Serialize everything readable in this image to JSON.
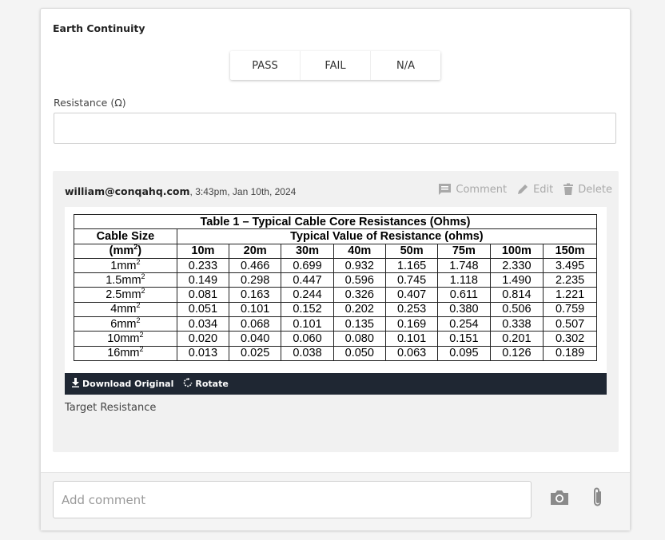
{
  "section": {
    "title": "Earth Continuity"
  },
  "options": [
    "PASS",
    "FAIL",
    "N/A"
  ],
  "resistance": {
    "label": "Resistance (Ω)",
    "value": ""
  },
  "comment": {
    "author": "william@conqahq.com",
    "timestamp": ", 3:43pm, Jan 10th, 2024",
    "actions": {
      "comment": "Comment",
      "edit": "Edit",
      "delete": "Delete"
    },
    "image_bar": {
      "download": "Download Original",
      "rotate": "Rotate"
    },
    "caption": "Target Resistance"
  },
  "table": {
    "title": "Table 1 – Typical Cable Core Resistances (Ohms)",
    "col_header": "Typical Value of Resistance (ohms)",
    "size_header_line1": "Cable Size",
    "size_header_line2": "(mm",
    "size_header_sup": "2",
    "size_header_line2_end": ")",
    "lengths": [
      "10m",
      "20m",
      "30m",
      "40m",
      "50m",
      "75m",
      "100m",
      "150m"
    ],
    "rows": [
      {
        "size": "1mm",
        "values": [
          "0.233",
          "0.466",
          "0.699",
          "0.932",
          "1.165",
          "1.748",
          "2.330",
          "3.495"
        ]
      },
      {
        "size": "1.5mm",
        "values": [
          "0.149",
          "0.298",
          "0.447",
          "0.596",
          "0.745",
          "1.118",
          "1.490",
          "2.235"
        ]
      },
      {
        "size": "2.5mm",
        "values": [
          "0.081",
          "0.163",
          "0.244",
          "0.326",
          "0.407",
          "0.611",
          "0.814",
          "1.221"
        ]
      },
      {
        "size": "4mm",
        "values": [
          "0.051",
          "0.101",
          "0.152",
          "0.202",
          "0.253",
          "0.380",
          "0.506",
          "0.759"
        ]
      },
      {
        "size": "6mm",
        "values": [
          "0.034",
          "0.068",
          "0.101",
          "0.135",
          "0.169",
          "0.254",
          "0.338",
          "0.507"
        ]
      },
      {
        "size": "10mm",
        "values": [
          "0.020",
          "0.040",
          "0.060",
          "0.080",
          "0.101",
          "0.151",
          "0.201",
          "0.302"
        ]
      },
      {
        "size": "16mm",
        "values": [
          "0.013",
          "0.025",
          "0.038",
          "0.050",
          "0.063",
          "0.095",
          "0.126",
          "0.189"
        ]
      }
    ]
  },
  "footer": {
    "placeholder": "Add comment",
    "camera_icon": "camera-icon",
    "attach_icon": "paperclip-icon"
  }
}
